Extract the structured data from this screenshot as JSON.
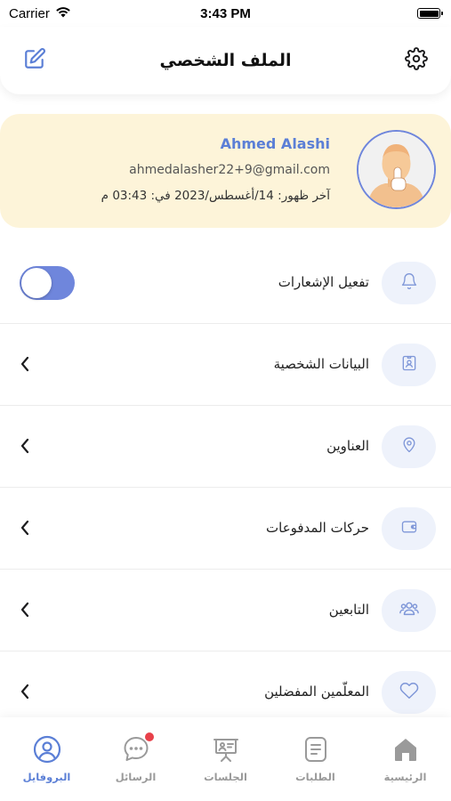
{
  "status_bar": {
    "carrier": "Carrier",
    "time": "3:43 PM"
  },
  "header": {
    "title": "الملف الشخصي",
    "left_icon": "edit-icon",
    "right_icon": "gear-icon"
  },
  "profile": {
    "name": "Ahmed Alashi",
    "email": "ahmedalasher22+9@gmail.com",
    "last_seen": "آخر ظهور:  14/أغسطس/2023 في: 03:43 م",
    "accent_color": "#5b7fd6",
    "card_color": "#fdf4d9"
  },
  "menu": {
    "items": [
      {
        "label": "تفعيل الإشعارات",
        "icon": "bell-icon",
        "control": "toggle",
        "toggle_on": true
      },
      {
        "label": "البيانات الشخصية",
        "icon": "id-card-icon",
        "control": "chevron"
      },
      {
        "label": "العناوين",
        "icon": "location-pin-icon",
        "control": "chevron"
      },
      {
        "label": "حركات المدفوعات",
        "icon": "wallet-icon",
        "control": "chevron"
      },
      {
        "label": "التابعين",
        "icon": "users-icon",
        "control": "chevron"
      },
      {
        "label": "المعلّمين المفضلين",
        "icon": "heart-icon",
        "control": "chevron"
      }
    ]
  },
  "tab_bar": {
    "tabs": [
      {
        "label": "البروفايل",
        "icon": "profile-icon",
        "active": true
      },
      {
        "label": "الرسائل",
        "icon": "chat-icon",
        "active": false,
        "badge": true
      },
      {
        "label": "الجلسات",
        "icon": "presentation-icon",
        "active": false
      },
      {
        "label": "الطلبات",
        "icon": "document-icon",
        "active": false
      },
      {
        "label": "الرئيسية",
        "icon": "home-icon",
        "active": false
      }
    ]
  }
}
